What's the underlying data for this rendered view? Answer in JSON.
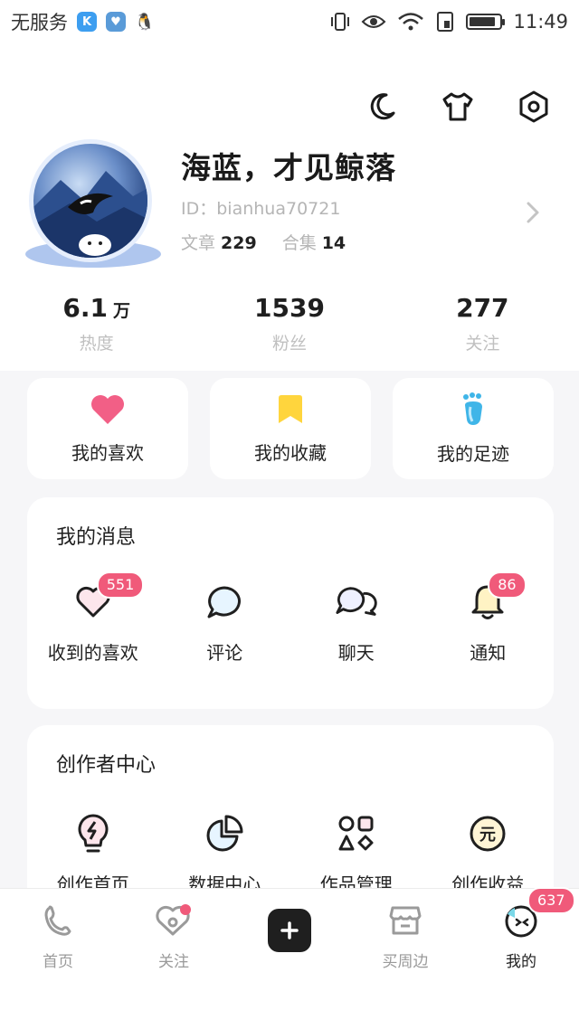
{
  "status_bar": {
    "carrier": "无服务",
    "time": "11:49",
    "battery_level": 0.85
  },
  "header": {
    "night_mode_icon": "moon-icon",
    "theme_icon": "tshirt-icon",
    "settings_icon": "hexagon-settings-icon"
  },
  "profile": {
    "name": "海蓝，才见鲸落",
    "id_text": "ID：bianhua70721",
    "articles_label": "文章",
    "articles_count": "229",
    "collections_label": "合集",
    "collections_count": "14"
  },
  "stats": [
    {
      "value": "6.1",
      "unit": "万",
      "label": "热度"
    },
    {
      "value": "1539",
      "unit": "",
      "label": "粉丝"
    },
    {
      "value": "277",
      "unit": "",
      "label": "关注"
    }
  ],
  "quick_actions": [
    {
      "label": "我的喜欢",
      "icon": "heart-icon",
      "color": "#f25f86"
    },
    {
      "label": "我的收藏",
      "icon": "bookmark-icon",
      "color": "#ffd53d"
    },
    {
      "label": "我的足迹",
      "icon": "footprint-icon",
      "color": "#3fb5e8"
    }
  ],
  "messages": {
    "title": "我的消息",
    "items": [
      {
        "label": "收到的喜欢",
        "icon": "heart-outline-icon",
        "badge": "551"
      },
      {
        "label": "评论",
        "icon": "comment-bubble-icon",
        "badge": ""
      },
      {
        "label": "聊天",
        "icon": "chat-bubbles-icon",
        "badge": ""
      },
      {
        "label": "通知",
        "icon": "bell-icon",
        "badge": "86"
      }
    ]
  },
  "creator": {
    "title": "创作者中心",
    "items": [
      {
        "label": "创作首页",
        "icon": "lightbulb-icon"
      },
      {
        "label": "数据中心",
        "icon": "pie-chart-icon"
      },
      {
        "label": "作品管理",
        "icon": "shapes-grid-icon"
      },
      {
        "label": "创作收益",
        "icon": "yuan-coin-icon"
      }
    ]
  },
  "tabbar": {
    "tabs": [
      {
        "label": "首页",
        "icon": "home-icon"
      },
      {
        "label": "关注",
        "icon": "follow-heart-icon"
      },
      {
        "label": "",
        "icon": "plus-icon"
      },
      {
        "label": "买周边",
        "icon": "shop-icon"
      },
      {
        "label": "我的",
        "icon": "face-icon",
        "badge": "637"
      }
    ]
  },
  "colors": {
    "accent_pink": "#f05a7a",
    "background": "#f6f6f8"
  }
}
